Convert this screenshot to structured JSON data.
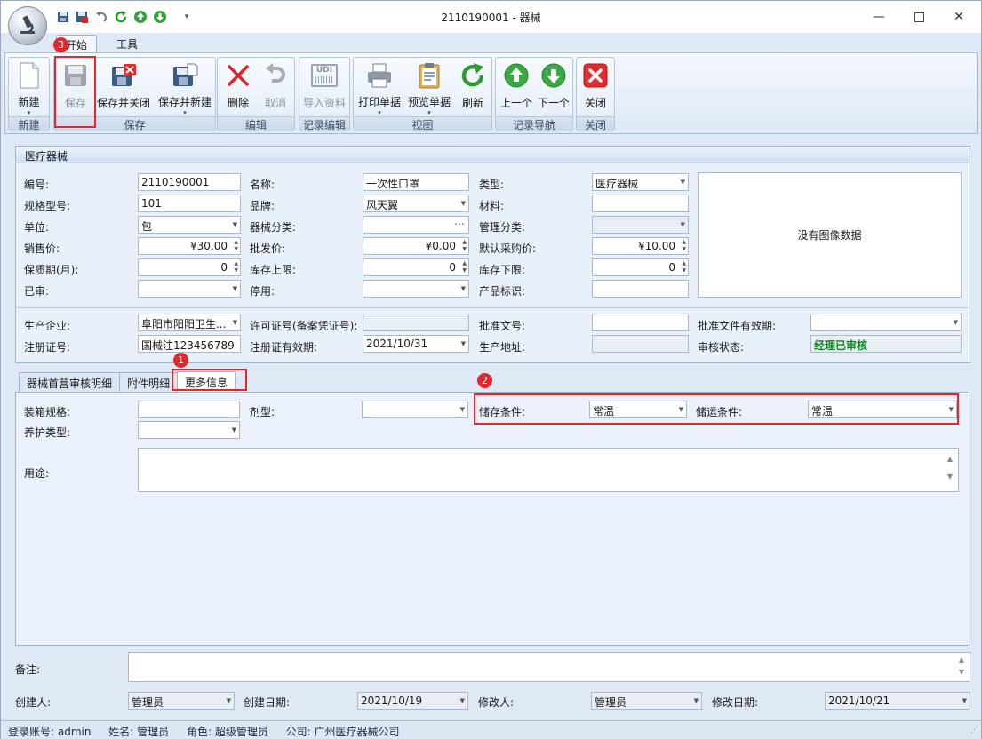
{
  "window": {
    "title": "2110190001 - 器械"
  },
  "ribbon": {
    "tabs": [
      "开始",
      "工具"
    ],
    "groups": {
      "new": {
        "label": "新建",
        "buttons": [
          "新建"
        ]
      },
      "save": {
        "label": "保存",
        "buttons": [
          "保存",
          "保存并关闭",
          "保存并新建"
        ]
      },
      "edit": {
        "label": "编辑",
        "buttons": [
          "删除",
          "取消"
        ]
      },
      "record_edit": {
        "label": "记录编辑",
        "buttons": [
          "导入资料"
        ]
      },
      "view": {
        "label": "视图",
        "buttons": [
          "打印单据",
          "预览单据",
          "刷新"
        ]
      },
      "nav": {
        "label": "记录导航",
        "buttons": [
          "上一个",
          "下一个"
        ]
      },
      "close": {
        "label": "关闭",
        "buttons": [
          "关闭"
        ]
      }
    },
    "udi_text": "UDI"
  },
  "main": {
    "title": "医疗器械",
    "labels": {
      "code": "编号:",
      "name": "名称:",
      "type": "类型:",
      "spec": "规格型号:",
      "brand": "品牌:",
      "material": "材料:",
      "unit": "单位:",
      "category": "器械分类:",
      "mgmt": "管理分类:",
      "price": "销售价:",
      "wholesale": "批发价:",
      "purchase": "默认采购价:",
      "shelf": "保质期(月):",
      "stock_max": "库存上限:",
      "stock_min": "库存下限:",
      "audited": "已审:",
      "disabled": "停用:",
      "product_mark": "产品标识:",
      "maker": "生产企业:",
      "license": "许可证号(备案凭证号):",
      "approval": "批准文号:",
      "approval_valid": "批准文件有效期:",
      "reg_no": "注册证号:",
      "reg_valid": "注册证有效期:",
      "address": "生产地址:",
      "audit_status": "审核状态:"
    },
    "values": {
      "code": "2110190001",
      "name": "一次性口罩",
      "type": "医疗器械",
      "spec": "101",
      "brand": "风天翼",
      "material": "",
      "unit": "包",
      "category": "",
      "mgmt": "",
      "price": "¥30.00",
      "wholesale": "¥0.00",
      "purchase": "¥10.00",
      "shelf": "0",
      "stock_max": "0",
      "stock_min": "0",
      "audited": "",
      "disabled": "",
      "product_mark": "",
      "maker": "阜阳市阳阳卫生...",
      "license": "",
      "approval": "",
      "approval_valid": "",
      "reg_no": "国械注123456789",
      "reg_valid": "2021/10/31",
      "address": "",
      "audit_status": "经理已审核"
    },
    "image_placeholder": "没有图像数据"
  },
  "detail_tabs": [
    "器械首营审核明细",
    "附件明细",
    "更多信息"
  ],
  "more": {
    "labels": {
      "pack_spec": "装箱规格:",
      "dosage": "剂型:",
      "storage": "储存条件:",
      "transport": "储运条件:",
      "care": "养护类型:",
      "usage": "用途:"
    },
    "values": {
      "pack_spec": "",
      "dosage": "",
      "storage": "常温",
      "transport": "常温",
      "care": "",
      "usage": ""
    }
  },
  "footer": {
    "remark_label": "备注:",
    "creator_label": "创建人:",
    "creator": "管理员",
    "created_label": "创建日期:",
    "created": "2021/10/19",
    "modifier_label": "修改人:",
    "modifier": "管理员",
    "modified_label": "修改日期:",
    "modified": "2021/10/21"
  },
  "annotations": [
    "1",
    "2",
    "3"
  ],
  "status": {
    "account": "登录账号: admin",
    "name": "姓名: 管理员",
    "role": "角色: 超级管理员",
    "company": "公司: 广州医疗器械公司"
  }
}
